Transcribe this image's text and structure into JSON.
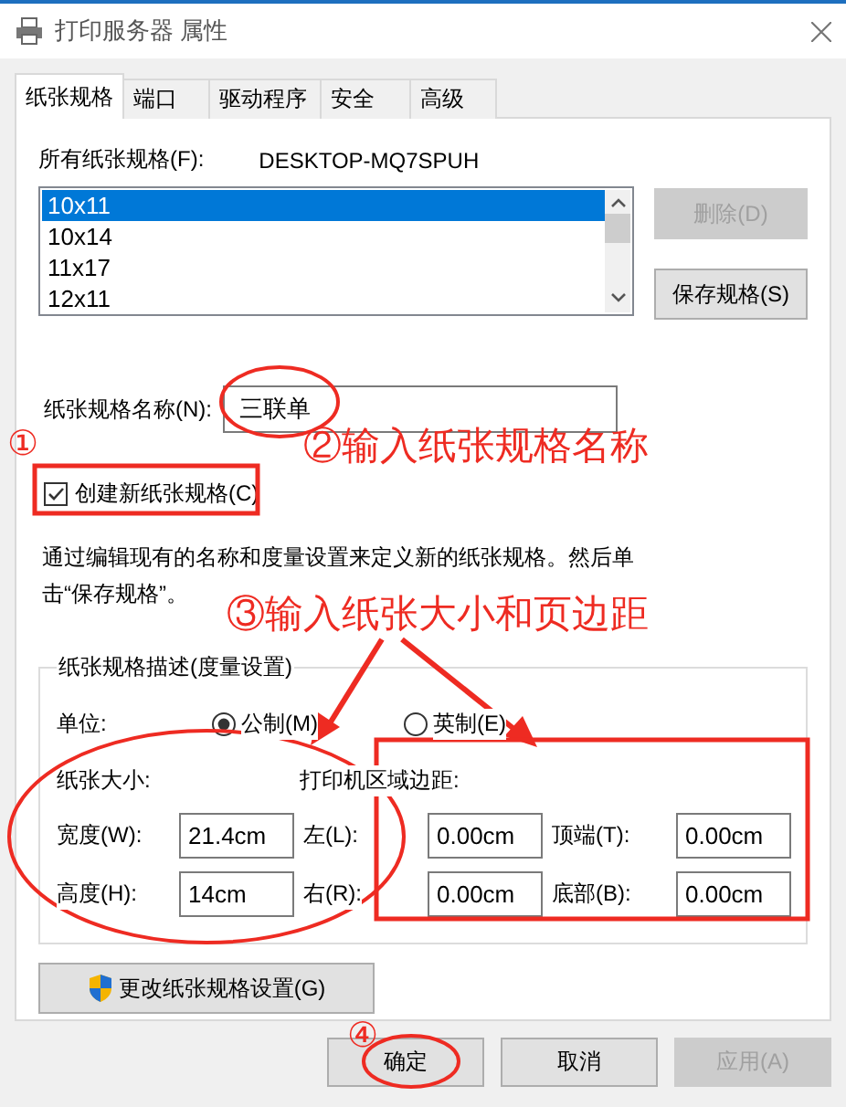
{
  "window": {
    "title": "打印服务器 属性"
  },
  "tabs": [
    {
      "label": "纸张规格",
      "selected": true
    },
    {
      "label": "端口",
      "selected": false
    },
    {
      "label": "驱动程序",
      "selected": false
    },
    {
      "label": "安全",
      "selected": false
    },
    {
      "label": "高级",
      "selected": false
    }
  ],
  "forms_label": "所有纸张规格(F):",
  "server_name": "DESKTOP-MQ7SPUH",
  "forms_list": [
    {
      "label": "10x11",
      "selected": true
    },
    {
      "label": "10x14",
      "selected": false
    },
    {
      "label": "11x17",
      "selected": false
    },
    {
      "label": "12x11",
      "selected": false
    }
  ],
  "side_buttons": [
    {
      "label": "删除(D)",
      "disabled": true
    },
    {
      "label": "保存规格(S)",
      "disabled": false
    }
  ],
  "form_name": {
    "label": "纸张规格名称(N):",
    "value": "三联单"
  },
  "create_new": {
    "label": "创建新纸张规格(C)",
    "checked": true
  },
  "description": "通过编辑现有的名称和度量设置来定义新的纸张规格。然后单击“保存规格”。",
  "group": {
    "title": "纸张规格描述(度量设置)",
    "units_label": "单位:",
    "units": [
      {
        "label": "公制(M)",
        "selected": true
      },
      {
        "label": "英制(E)",
        "selected": false
      }
    ],
    "paper_size_label": "纸张大小:",
    "margins_label": "打印机区域边距:",
    "fields": [
      {
        "label": "宽度(W):",
        "value": "21.4cm"
      },
      {
        "label": "左(L):",
        "value": "0.00cm"
      },
      {
        "label": "顶端(T):",
        "value": "0.00cm"
      },
      {
        "label": "高度(H):",
        "value": "14cm"
      },
      {
        "label": "右(R):",
        "value": "0.00cm"
      },
      {
        "label": "底部(B):",
        "value": "0.00cm"
      }
    ]
  },
  "change_settings_button": "更改纸张规格设置(G)",
  "buttons": [
    {
      "label": "确定",
      "disabled": false
    },
    {
      "label": "取消",
      "disabled": false
    },
    {
      "label": "应用(A)",
      "disabled": true
    }
  ],
  "annotations": [
    "①",
    "②输入纸张规格名称",
    "③输入纸张大小和页边距",
    "④"
  ]
}
